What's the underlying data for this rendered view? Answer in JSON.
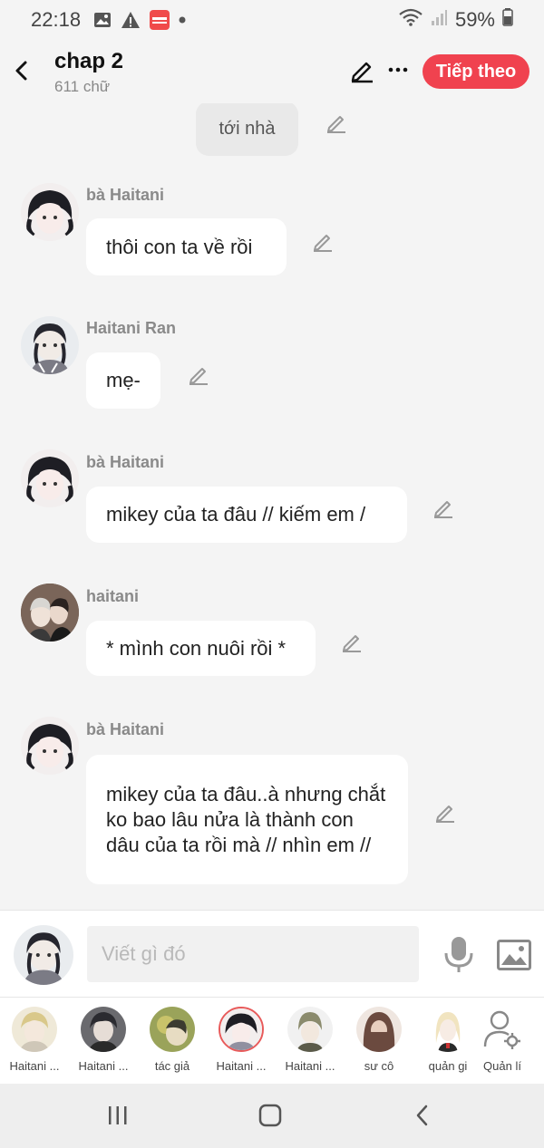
{
  "status_bar": {
    "time": "22:18",
    "battery": "59%"
  },
  "header": {
    "title": "chap 2",
    "subtitle": "611 chữ",
    "next_label": "Tiếp theo"
  },
  "messages": [
    {
      "type": "narration",
      "text": "tới nhà"
    },
    {
      "type": "char",
      "name": "bà Haitani",
      "text": "thôi con ta về rồi"
    },
    {
      "type": "char",
      "name": "Haitani Ran",
      "text": "mẹ-"
    },
    {
      "type": "char",
      "name": "bà Haitani",
      "text": "mikey của ta đâu // kiếm em /"
    },
    {
      "type": "char",
      "name": "haitani",
      "text": "* mình con nuôi rồi *"
    },
    {
      "type": "char",
      "name": "bà Haitani",
      "text": "mikey của ta đâu..à nhưng chắt ko bao lâu nửa là thành con dâu của ta  rồi mà // nhìn em //"
    }
  ],
  "composer": {
    "placeholder": "Viết gì đó"
  },
  "characters": [
    {
      "label": "Haitani ..."
    },
    {
      "label": "Haitani ..."
    },
    {
      "label": "tác giả"
    },
    {
      "label": "Haitani ..."
    },
    {
      "label": "Haitani ..."
    },
    {
      "label": "sư cô"
    },
    {
      "label": "quản gi"
    },
    {
      "label": "Quản lí"
    }
  ],
  "colors": {
    "accent": "#f0424f",
    "bubble": "#ffffff",
    "background": "#f4f4f4"
  }
}
